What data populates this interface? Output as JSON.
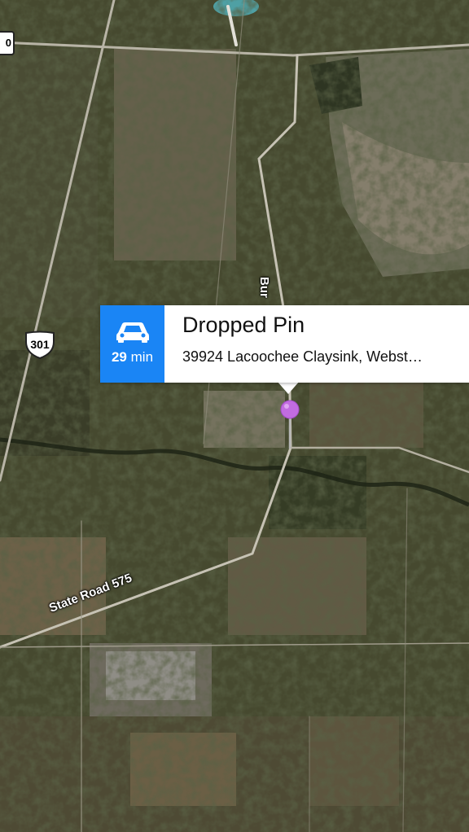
{
  "callout": {
    "title": "Dropped Pin",
    "address": "39924 Lacoochee Claysink, Webst…",
    "eta_value": "29",
    "eta_unit": "min",
    "accent": "#1a85f5"
  },
  "map": {
    "road_label_state": "State Road 575",
    "road_label_partial": "Bur",
    "shield_number": "301",
    "corner_shield_partial": "0",
    "pin_color": "#c26ce0"
  },
  "icons": {
    "directions": "car-icon",
    "pin": "map-pin-icon"
  }
}
